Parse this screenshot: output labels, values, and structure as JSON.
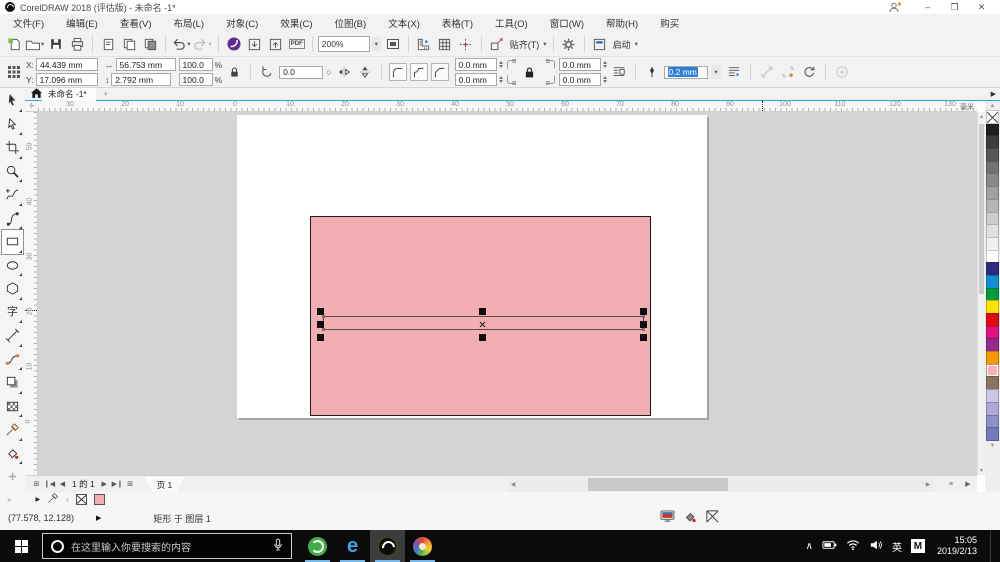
{
  "titlebar": {
    "title": "CorelDRAW 2018 (评估版) - 未命名 -1*",
    "minimize_glyph": "–",
    "restore_glyph": "❐",
    "close_glyph": "✕"
  },
  "menu": {
    "items": [
      "文件(F)",
      "编辑(E)",
      "查看(V)",
      "布局(L)",
      "对象(C)",
      "效果(C)",
      "位图(B)",
      "文本(X)",
      "表格(T)",
      "工具(O)",
      "窗口(W)",
      "帮助(H)",
      "购买"
    ]
  },
  "toolbar": {
    "zoom_level": "200%",
    "pdf_label": "PDF",
    "snap_label": "贴齐(T)",
    "launch_label": "启动"
  },
  "property_bar": {
    "x_label": "X:",
    "y_label": "Y:",
    "x_value": "44.439 mm",
    "y_value": "17.096 mm",
    "width_value": "56.753 mm",
    "height_value": "2.792 mm",
    "scale_h": "100.0",
    "scale_v": "100.0",
    "percent_h": "%",
    "percent_v": "%",
    "rotation_value": "0.0",
    "corner_top_left": "0.0 mm",
    "corner_bottom_left": "0.0 mm",
    "corner_top_right": "0.0 mm",
    "corner_bottom_right": "0.0 mm",
    "outline_width": "0.2 mm"
  },
  "document_tabs": {
    "active": "未命名 -1*",
    "new_tab": "+"
  },
  "rulers": {
    "h_labels": [
      "30",
      "20",
      "10",
      "0",
      "10",
      "20",
      "30",
      "40",
      "50",
      "60",
      "70",
      "80",
      "90",
      "100",
      "110",
      "120",
      "130"
    ],
    "v_labels": [
      "50",
      "40",
      "30",
      "20",
      "10",
      "0"
    ],
    "unit": "毫米"
  },
  "toolbox": {
    "active": "rectangle",
    "text_glyph": "字",
    "tools": [
      "pick",
      "shape",
      "crop",
      "zoom",
      "freehand",
      "bezier",
      "rectangle",
      "ellipse",
      "polygon",
      "text",
      "dimension",
      "connector",
      "drop-shadow",
      "transparency",
      "eyedropper",
      "interactive-fill",
      "more"
    ]
  },
  "canvas": {
    "page_color": "#ffffff",
    "rect_fill": "#f2aeb3",
    "rect_outline": "#1c1c1c"
  },
  "palette": {
    "selected_index": 20,
    "colors": [
      "none",
      "#1f1e1c",
      "#3e3d3c",
      "#585756",
      "#727170",
      "#8a8988",
      "#a1a09f",
      "#b7b6b5",
      "#cccccb",
      "#e0e0df",
      "#f1f1f0",
      "#ffffff",
      "#2d2a7f",
      "#0f90d3",
      "#019a3f",
      "#ffe300",
      "#e30b13",
      "#e5107e",
      "#942a8d",
      "#f59b00",
      "#f4b1b6",
      "#897463",
      "#cac8e3",
      "#adaad5",
      "#8c91c8",
      "#747abc"
    ]
  },
  "navigator": {
    "page_info": "1 的 1",
    "page_tab": "页 1"
  },
  "status_bar": {
    "coords": "(77.578, 12.128)",
    "object_info": "矩形 于 图层 1",
    "fill_swatch": "#f2aeb3"
  },
  "taskbar": {
    "search_placeholder": "在这里输入你要搜索的内容",
    "language": "英",
    "ime_label": "M",
    "time": "15:05",
    "date": "2019/2/13"
  }
}
